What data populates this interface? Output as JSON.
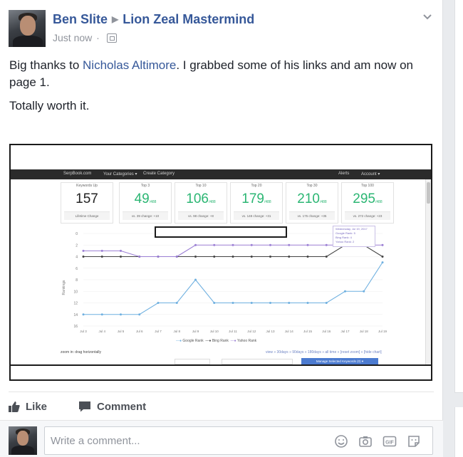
{
  "post": {
    "author": "Ben Slite",
    "group": "Lion Zeal Mastermind",
    "timestamp": "Just now",
    "paragraphs": {
      "p1_before": "Big thanks to ",
      "mention": "Nicholas Altimore",
      "p1_after": ". I grabbed some of his links and am now on page 1.",
      "p2": "Totally worth it."
    }
  },
  "screenshot": {
    "appbar": {
      "brand": "SerpBook.com",
      "categories": "Your Categories ▾",
      "create": "Create Category",
      "alerts": "Alerts",
      "account": "Account ▾"
    },
    "stats": [
      {
        "caption": "Keywords Up",
        "value": "157",
        "unit": "",
        "sub": "Lifetime Change"
      },
      {
        "caption": "Top 3",
        "value": "49",
        "unit": "/488",
        "sub": "vs. 39 change: +10"
      },
      {
        "caption": "Top 10",
        "value": "106",
        "unit": "/488",
        "sub": "vs. 98 change: +8"
      },
      {
        "caption": "Top 20",
        "value": "179",
        "unit": "/488",
        "sub": "vs. 148 change: +31"
      },
      {
        "caption": "Top 30",
        "value": "210",
        "unit": "/488",
        "sub": "vs. 175 change: +35"
      },
      {
        "caption": "Top 100",
        "value": "295",
        "unit": "/488",
        "sub": "vs. 272 change: +23"
      }
    ],
    "tooltip": {
      "line1": "Wednesday, Jul 19, 2017",
      "line2": "Google Rank: 5",
      "line3": "Bing Rank: 4",
      "line4": "Yahoo Rank: 2"
    },
    "zoom_hint": "zoom in: drag horizontally",
    "view_links": "view » 30days » 90days » 180days » all time » [reset zoom] » [hide chart]",
    "manage_button": "Manage Selected Keywords (0) ▾",
    "legend": [
      "Google Rank",
      "Bing Rank",
      "Yahoo Rank"
    ]
  },
  "chart_data": {
    "type": "line",
    "x": [
      "Jul 3",
      "Jul 4",
      "Jul 5",
      "Jul 6",
      "Jul 7",
      "Jul 8",
      "Jul 9",
      "Jul 10",
      "Jul 11",
      "Jul 12",
      "Jul 13",
      "Jul 14",
      "Jul 15",
      "Jul 16",
      "Jul 17",
      "Jul 18",
      "Jul 19"
    ],
    "yticks": [
      0,
      2,
      4,
      6,
      8,
      10,
      12,
      14,
      16
    ],
    "ylabel": "Rankings",
    "ylim": [
      16,
      0
    ],
    "series": [
      {
        "name": "Google Rank",
        "color": "#6fb0e0",
        "values": [
          14,
          14,
          14,
          14,
          12,
          12,
          8,
          12,
          12,
          12,
          12,
          12,
          12,
          12,
          10,
          10,
          5
        ]
      },
      {
        "name": "Bing Rank",
        "color": "#444444",
        "values": [
          4,
          4,
          4,
          4,
          4,
          4,
          4,
          4,
          4,
          4,
          4,
          4,
          4,
          4,
          2,
          2,
          4
        ]
      },
      {
        "name": "Yahoo Rank",
        "color": "#9b7fd4",
        "values": [
          3,
          3,
          3,
          4,
          4,
          4,
          2,
          2,
          2,
          2,
          2,
          2,
          2,
          2,
          2,
          2,
          2
        ]
      }
    ]
  },
  "actions": {
    "like": "Like",
    "comment": "Comment"
  },
  "composer": {
    "placeholder": "Write a comment..."
  },
  "colors": {
    "link": "#365899",
    "meta": "#90949c",
    "green": "#2bb673"
  }
}
